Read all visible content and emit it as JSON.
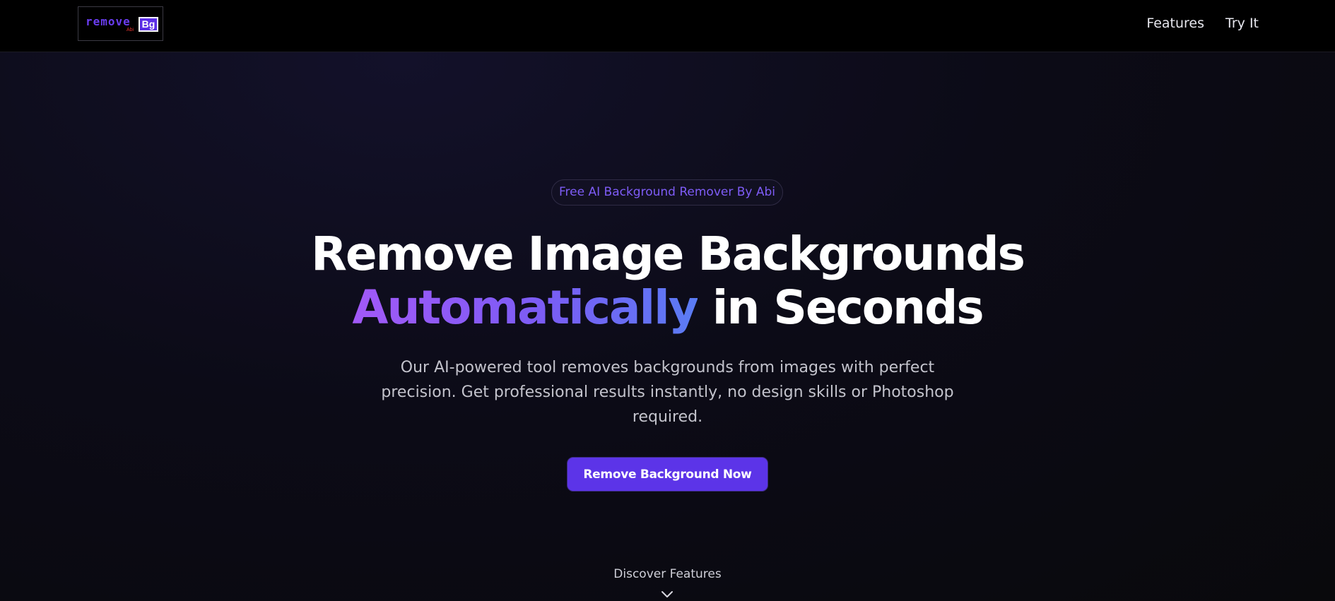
{
  "logo": {
    "word": "remove",
    "sub": "Abi",
    "badge": "Bg"
  },
  "nav": {
    "links": [
      "Features",
      "Try It"
    ]
  },
  "hero": {
    "tagline": "Free AI Background Remover By Abi",
    "headline_line1": "Remove Image Backgrounds",
    "headline_highlight": "Automatically",
    "headline_rest": " in Seconds",
    "description": "Our AI-powered tool removes backgrounds from images with perfect precision. Get professional results instantly, no design skills or Photoshop required.",
    "cta_label": "Remove Background Now",
    "discover_label": "Discover Features"
  },
  "colors": {
    "accent": "#5c34e8",
    "gradient_start": "#a259f7",
    "gradient_end": "#5a7cf3",
    "pill_text": "#7e5cf6"
  },
  "icons": {
    "scroll_indicator": "chevron-down-icon"
  }
}
